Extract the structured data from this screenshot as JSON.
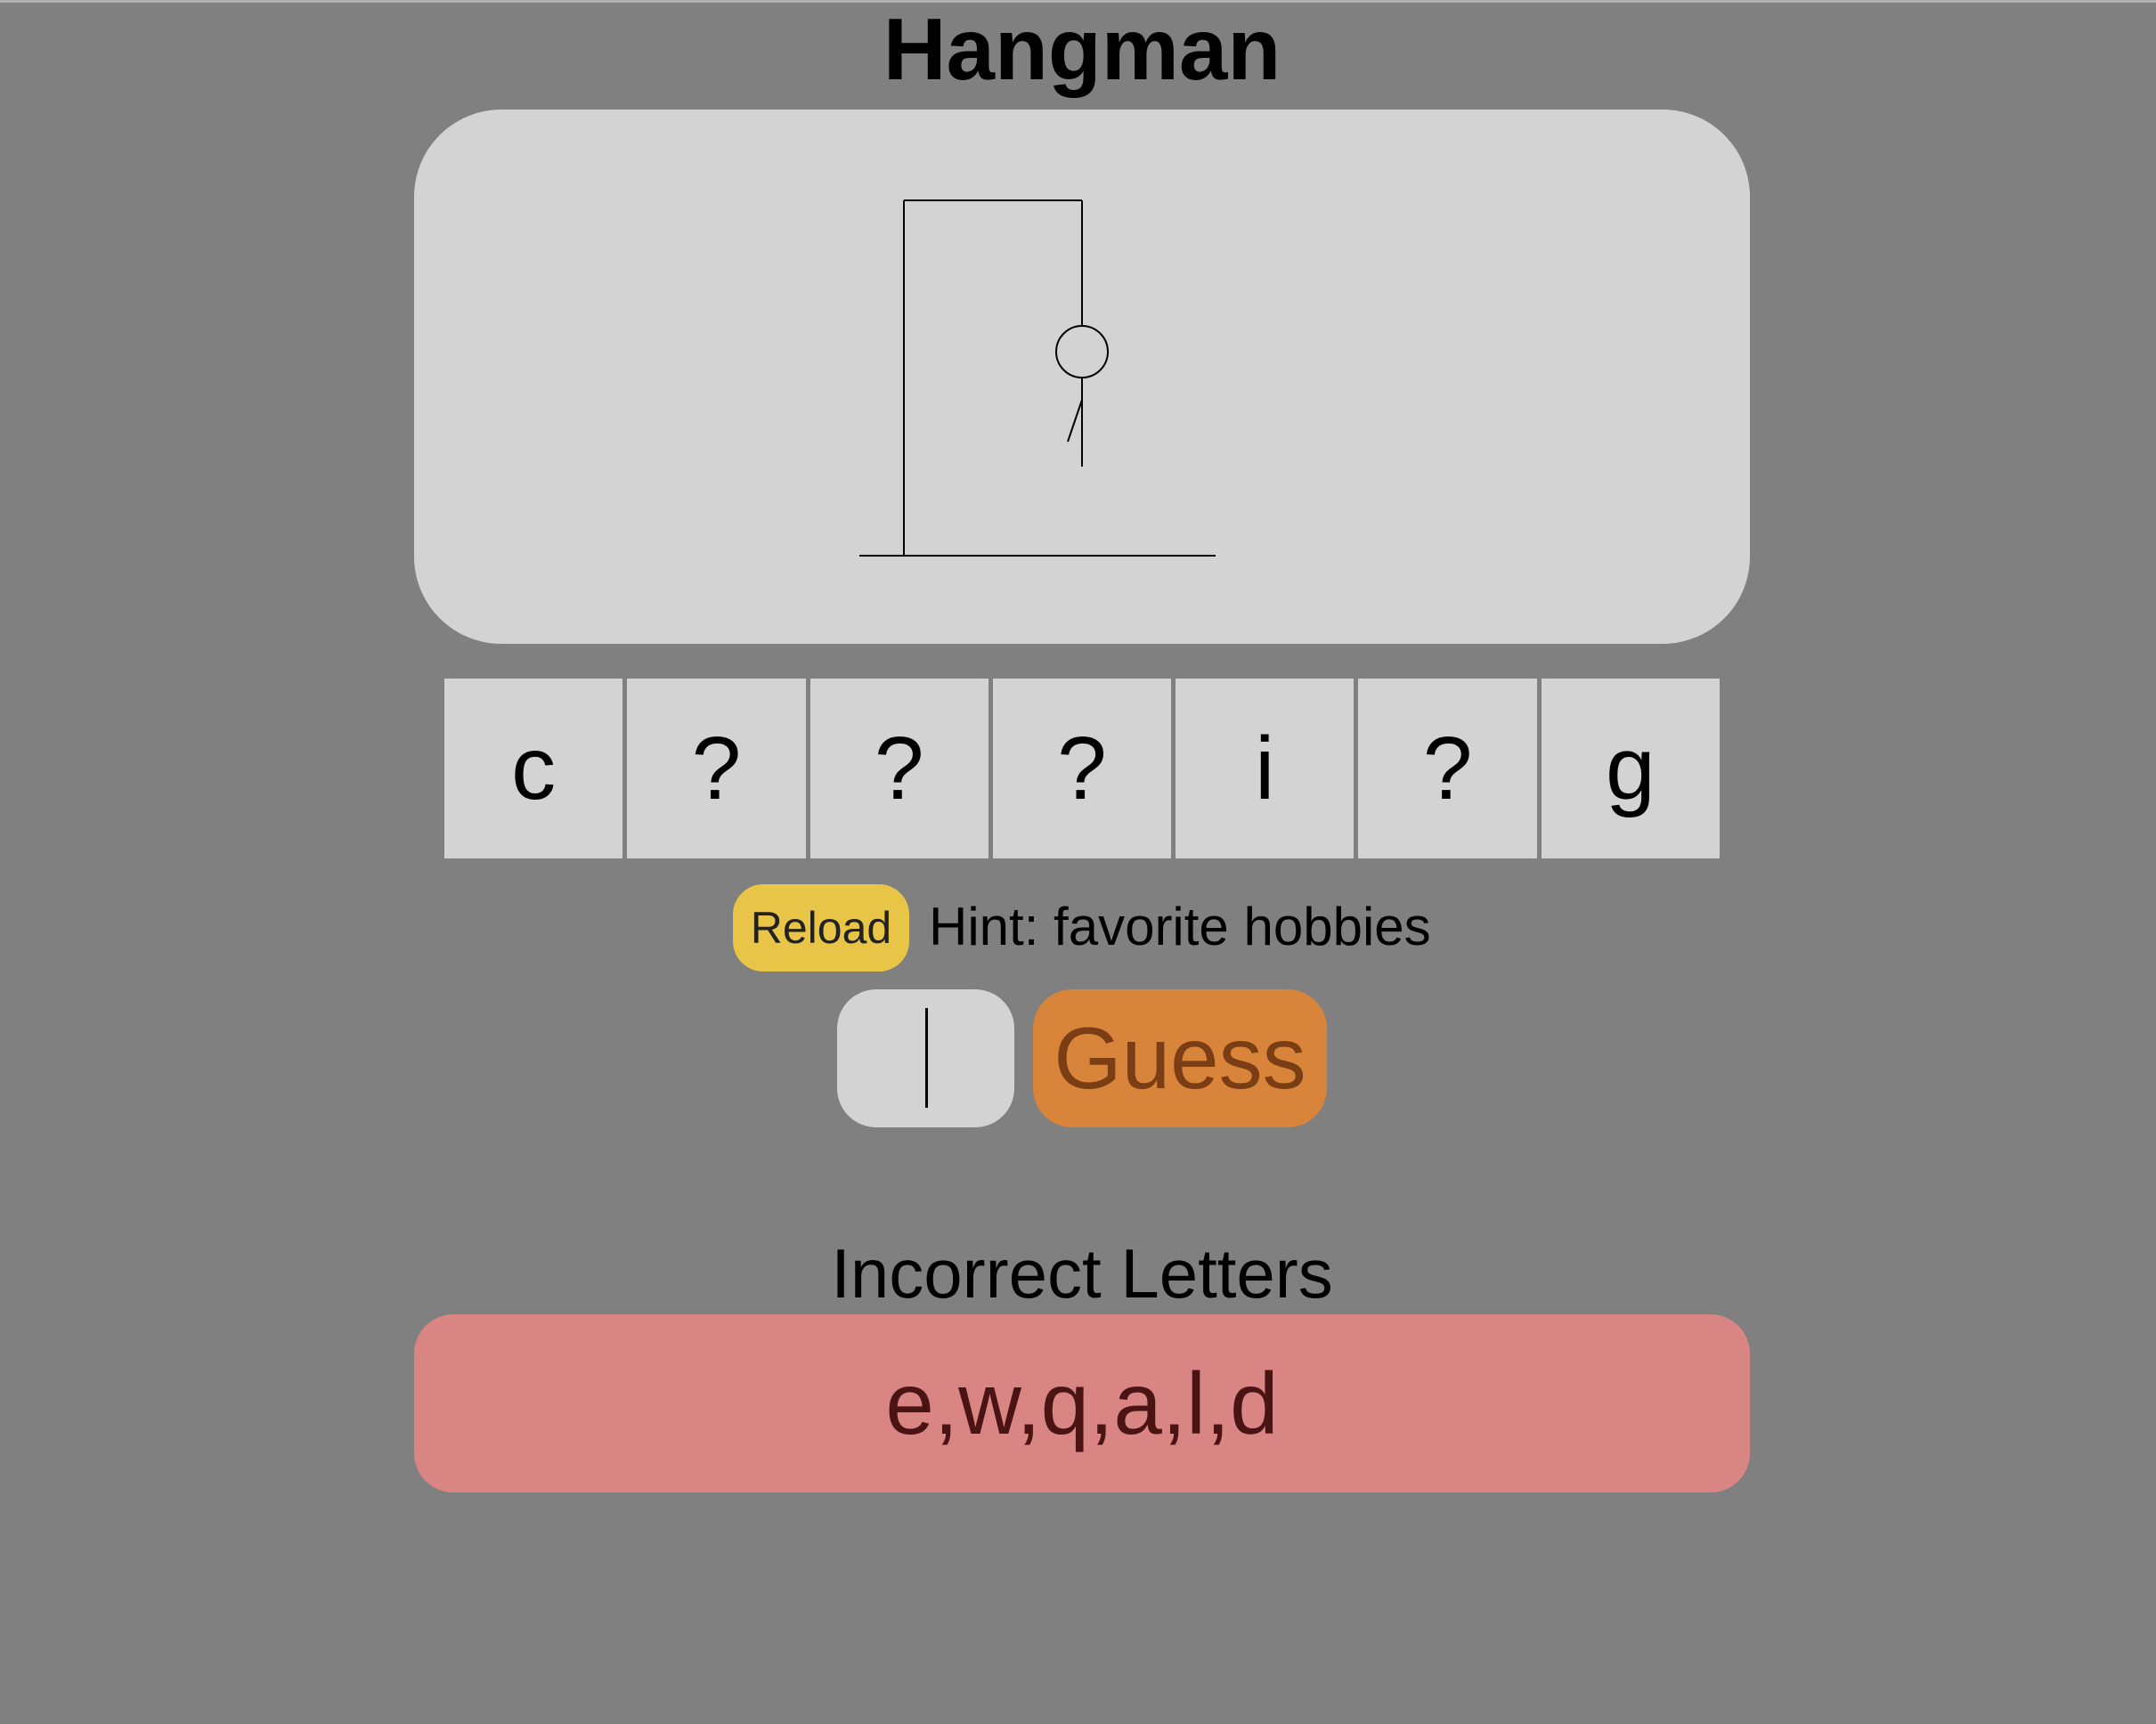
{
  "title": "Hangman",
  "game": {
    "wrong_guess_count": 6,
    "drawn_parts": [
      "head",
      "body",
      "left-arm"
    ]
  },
  "word": {
    "cells": [
      "c",
      "?",
      "?",
      "?",
      "i",
      "?",
      "g"
    ]
  },
  "controls": {
    "reload_label": "Reload",
    "hint": "Hint: favorite hobbies",
    "guess_input_value": "",
    "guess_label": "Guess"
  },
  "incorrect": {
    "heading": "Incorrect Letters",
    "letters": "e,w,q,a,l,d"
  },
  "colors": {
    "background": "#808080",
    "board": "#d3d3d3",
    "reload_button": "#e8c547",
    "guess_button": "#d9843b",
    "incorrect_panel": "#d98583"
  }
}
